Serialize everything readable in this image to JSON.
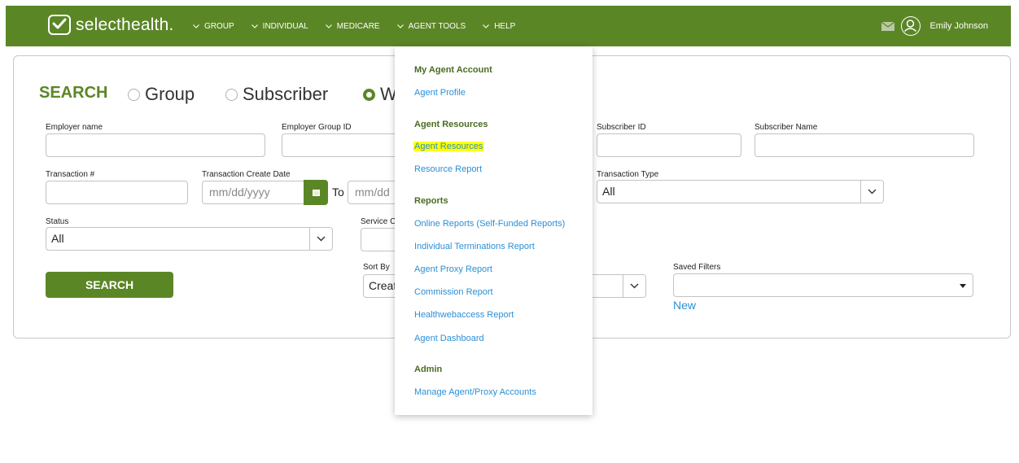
{
  "header": {
    "brand": "selecthealth.",
    "nav": [
      "GROUP",
      "INDIVIDUAL",
      "MEDICARE",
      "AGENT TOOLS",
      "HELP"
    ],
    "user_name": "Emily Johnson"
  },
  "search": {
    "title": "SEARCH",
    "options": [
      "Group",
      "Subscriber",
      "W"
    ],
    "labels": {
      "employer_name": "Employer name",
      "employer_group_id": "Employer Group ID",
      "subscriber_id": "Subscriber ID",
      "subscriber_name": "Subscriber Name",
      "transaction_no": "Transaction #",
      "transaction_create_date": "Transaction Create Date",
      "transaction_type": "Transaction Type",
      "status": "Status",
      "service": "Service C",
      "sort_by": "Sort By",
      "saved_filters": "Saved Filters"
    },
    "date_placeholder_from": "mm/dd/yyyy",
    "date_placeholder_to": "mm/dd",
    "to_label": "To",
    "transaction_type_value": "All",
    "status_value": "All",
    "sort_by_value": "Creat",
    "search_button": "SEARCH",
    "new_link": "New"
  },
  "dropdown": {
    "sections": [
      {
        "heading": "My Agent Account",
        "links": [
          "Agent Profile"
        ]
      },
      {
        "heading": "Agent Resources",
        "links": [
          "Agent Resources",
          "Resource Report"
        ]
      },
      {
        "heading": "Reports",
        "links": [
          "Online Reports (Self-Funded Reports)",
          "Individual Terminations Report",
          "Agent Proxy Report",
          "Commission Report",
          "Healthwebaccess Report",
          "Agent Dashboard"
        ]
      },
      {
        "heading": "Admin",
        "links": [
          "Manage Agent/Proxy Accounts"
        ]
      }
    ]
  },
  "colors": {
    "brand_green": "#5b8626",
    "link_blue": "#2b8fd6",
    "highlight": "#ffff00"
  }
}
